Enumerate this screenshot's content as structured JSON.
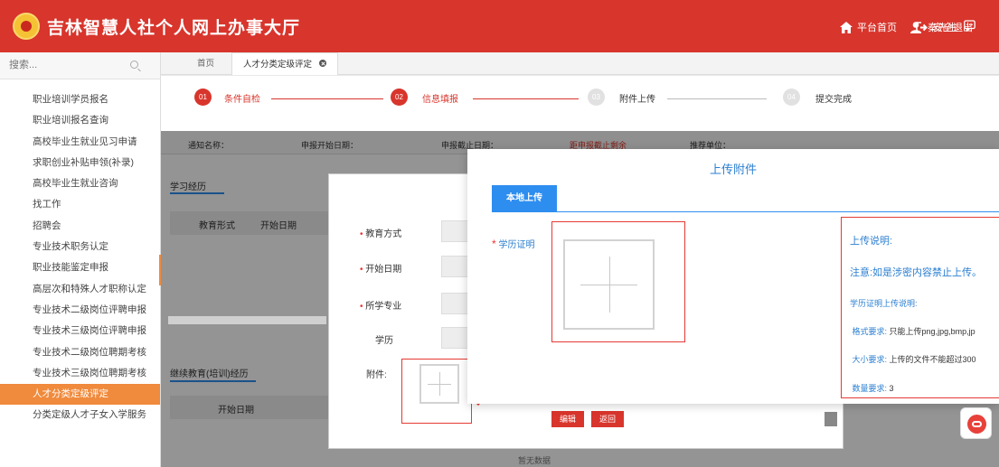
{
  "header": {
    "title": "吉林智慧人社个人网上办事大厅",
    "nav": {
      "home": "平台首页",
      "user": "秦先生",
      "logout": "安全退出"
    }
  },
  "sidebar": {
    "search_placeholder": "搜索...",
    "items": [
      "职业培训学员报名",
      "职业培训报名查询",
      "高校毕业生就业见习申请",
      "求职创业补贴申领(补录)",
      "高校毕业生就业咨询",
      "找工作",
      "招聘会",
      "专业技术职务认定",
      "职业技能鉴定申报",
      "高层次和特殊人才职称认定",
      "专业技术二级岗位评聘申报",
      "专业技术三级岗位评聘申报",
      "专业技术二级岗位聘期考核",
      "专业技术三级岗位聘期考核",
      "人才分类定级评定",
      "分类定级人才子女入学服务"
    ]
  },
  "tabs": {
    "home": "首页",
    "current": "人才分类定级评定"
  },
  "steps": [
    {
      "num": "01",
      "label": "条件自检"
    },
    {
      "num": "02",
      "label": "信息填报"
    },
    {
      "num": "03",
      "label": "附件上传"
    },
    {
      "num": "04",
      "label": "提交完成"
    }
  ],
  "background": {
    "notice_name": "通知名称：",
    "apply_start": "申报开始日期：",
    "apply_end": "申报截止日期：",
    "remaining": "距申报截止剩余",
    "recommend_unit": "推荐单位：",
    "study_section": "学习经历",
    "col_edu_form": "教育形式",
    "col_start": "开始日期",
    "continuing_section": "继续教育(培训)经历",
    "col_start2": "开始日期",
    "bottom_text": "暂无数据"
  },
  "form_modal": {
    "edu_method": "教育方式",
    "start_date": "开始日期",
    "major": "所学专业",
    "degree": "学历",
    "attachment": "附件:",
    "edit": "编辑",
    "back": "返回"
  },
  "upload_dialog": {
    "title": "上传附件",
    "tab": "本地上传",
    "field_label": "学历证明",
    "info": {
      "heading": "上传说明:",
      "warning": "注意:如是涉密内容禁止上传。",
      "sub": "学历证明上传说明:",
      "format_label": "格式要求:",
      "format_value": "只能上传png,jpg,bmp,jp",
      "size_label": "大小要求:",
      "size_value": "上传的文件不能超过300",
      "count_label": "数量要求:",
      "count_value": "3"
    }
  },
  "colors": {
    "brand_red": "#d8352c",
    "accent_orange": "#f08a3c",
    "dialog_blue": "#2e8ef0",
    "highlight_red": "#e53a33"
  }
}
